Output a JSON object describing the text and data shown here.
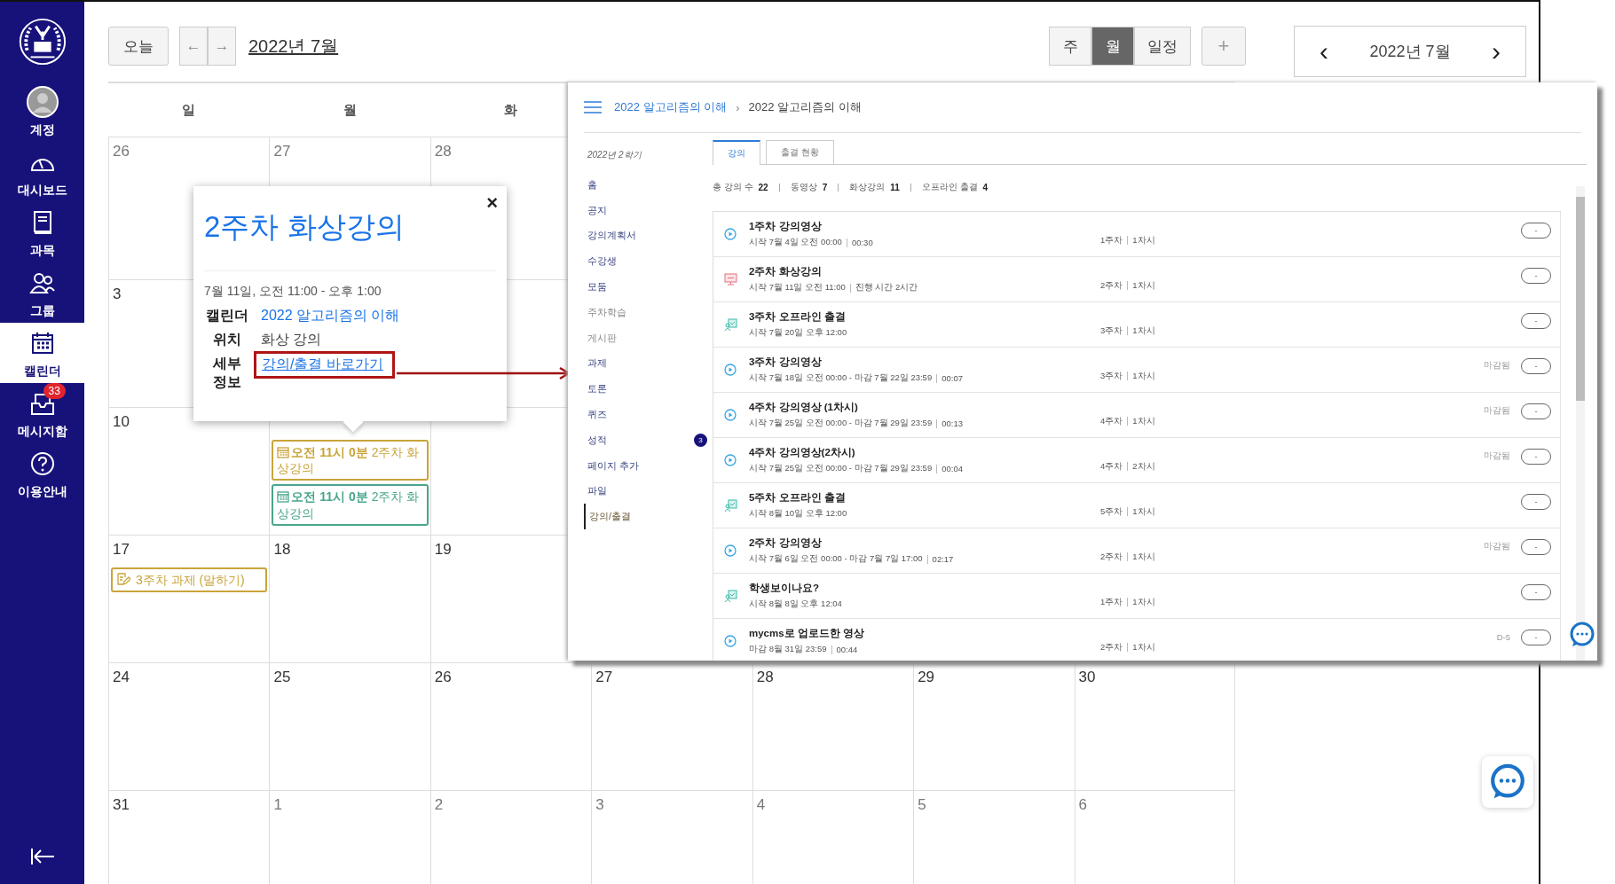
{
  "sidebar": {
    "items": [
      {
        "kind": "account",
        "label": "계정",
        "selected": false
      },
      {
        "kind": "dashboard",
        "label": "대시보드",
        "selected": false
      },
      {
        "kind": "courses",
        "label": "과목",
        "selected": false
      },
      {
        "kind": "groups",
        "label": "그룹",
        "selected": false
      },
      {
        "kind": "calendar",
        "label": "캘린더",
        "selected": true
      },
      {
        "kind": "inbox",
        "label": "메시지함",
        "selected": false,
        "badge": "33"
      },
      {
        "kind": "help",
        "label": "이용안내",
        "selected": false
      }
    ]
  },
  "toolbar": {
    "today": "오늘",
    "prev": "←",
    "next": "→",
    "title": "2022년 7월",
    "views": [
      {
        "label": "주",
        "selected": false
      },
      {
        "label": "월",
        "selected": true
      },
      {
        "label": "일정",
        "selected": false
      }
    ],
    "add": "+"
  },
  "mini_calendar": {
    "prev": "‹",
    "title": "2022년 7월",
    "next": "›"
  },
  "calendar": {
    "weekdays": [
      "일",
      "월",
      "화"
    ],
    "weeks": [
      [
        {
          "day": "26",
          "outside": true
        },
        {
          "day": "27",
          "outside": true
        },
        {
          "day": "28",
          "outside": true
        }
      ],
      [
        {
          "day": "3",
          "outside": false
        }
      ],
      [
        {
          "day": "10",
          "outside": false
        },
        {
          "events": [
            {
              "kind": "event",
              "time": "오전 11시 0분",
              "title": "2주차 화상강의",
              "color": "#c9a43a"
            },
            {
              "kind": "event",
              "time": "오전 11시 0분",
              "title": "2주차 화상강의",
              "color": "#4aa58c"
            }
          ]
        }
      ],
      [
        {
          "day": "17",
          "outside": false,
          "events": [
            {
              "kind": "assignment",
              "title": "3주차 과제 (말하기)",
              "color": "#c9a43a"
            }
          ]
        },
        {
          "day": "18",
          "outside": false
        },
        {
          "day": "19",
          "outside": false
        }
      ],
      [
        {
          "day": "24",
          "outside": false
        },
        {
          "day": "25",
          "outside": false
        },
        {
          "day": "26",
          "outside": false
        },
        {
          "day": "27",
          "outside": false
        },
        {
          "day": "28",
          "outside": false
        },
        {
          "day": "29",
          "outside": false
        },
        {
          "day": "30",
          "outside": false
        }
      ],
      [
        {
          "day": "31",
          "outside": false
        },
        {
          "day": "1",
          "outside": true
        },
        {
          "day": "2",
          "outside": true
        },
        {
          "day": "3",
          "outside": true
        },
        {
          "day": "4",
          "outside": true
        },
        {
          "day": "5",
          "outside": true
        },
        {
          "day": "6",
          "outside": true
        }
      ]
    ]
  },
  "popover": {
    "close": "×",
    "title": "2주차 화상강의",
    "when": "7월 11일, 오전 11:00 - 오후 1:00",
    "rows": [
      {
        "kind": "link",
        "label": "캘린더",
        "value": "2022 알고리즘의 이해"
      },
      {
        "kind": "text",
        "label": "위치",
        "value": "화상 강의"
      },
      {
        "kind": "highlight",
        "label": "세부 정보",
        "value": "강의/출결 바로가기"
      }
    ]
  },
  "course_page": {
    "breadcrumb": [
      "2022 알고리즘의 이해",
      "›",
      "2022 알고리즘의 이해"
    ],
    "term": "2022년 2학기",
    "nav": [
      {
        "label": "홈",
        "selected": false,
        "disabled": false
      },
      {
        "label": "공지",
        "selected": false,
        "disabled": false
      },
      {
        "label": "강의계획서",
        "selected": false,
        "disabled": false
      },
      {
        "label": "수강생",
        "selected": false,
        "disabled": false
      },
      {
        "label": "모둠",
        "selected": false,
        "disabled": false
      },
      {
        "label": "주차학습",
        "selected": false,
        "disabled": true
      },
      {
        "label": "게시판",
        "selected": false,
        "disabled": true
      },
      {
        "label": "과제",
        "selected": false,
        "disabled": false
      },
      {
        "label": "토론",
        "selected": false,
        "disabled": false
      },
      {
        "label": "퀴즈",
        "selected": false,
        "disabled": false
      },
      {
        "label": "성적",
        "selected": false,
        "disabled": false,
        "badge": "3"
      },
      {
        "label": "페이지 추가",
        "selected": false,
        "disabled": false
      },
      {
        "label": "파일",
        "selected": false,
        "disabled": false
      },
      {
        "label": "강의/출결",
        "selected": true,
        "disabled": false
      }
    ],
    "tabs": [
      {
        "label": "강의",
        "selected": true
      },
      {
        "label": "출결 현황",
        "selected": false
      }
    ],
    "stats": [
      {
        "label": "총 강의 수",
        "value": "22"
      },
      {
        "label": "동영상",
        "value": "7"
      },
      {
        "label": "화상강의",
        "value": "11"
      },
      {
        "label": "오프라인 출결",
        "value": "4"
      }
    ],
    "lectures": [
      {
        "kind": "video",
        "title": "1주차 강의영상",
        "meta": [
          "시작  7월 4일 오전 00:00",
          "00:30"
        ],
        "week": "1주차",
        "period": "1차시",
        "action": "-"
      },
      {
        "kind": "live",
        "title": "2주차 화상강의",
        "meta": [
          "시작  7월 11일 오전 11:00",
          "진행 시간 2시간"
        ],
        "week": "2주차",
        "period": "1차시",
        "action": "-"
      },
      {
        "kind": "offline",
        "title": "3주차 오프라인 출결",
        "meta": [
          "시작  7월 20일 오후 12:00"
        ],
        "week": "3주차",
        "period": "1차시",
        "action": "-"
      },
      {
        "kind": "video",
        "title": "3주차 강의영상",
        "meta": [
          "시작  7월 18일 오전 00:00  -  마감  7월 22일 23:59",
          "00:07"
        ],
        "week": "3주차",
        "period": "1차시",
        "status": "마감됨",
        "action": "-"
      },
      {
        "kind": "video",
        "title": "4주차 강의영상 (1차시)",
        "meta": [
          "시작  7월 25일 오전 00:00  -  마감  7월 29일 23:59",
          "00:13"
        ],
        "week": "4주차",
        "period": "1차시",
        "status": "마감됨",
        "action": "-"
      },
      {
        "kind": "video",
        "title": "4주차 강의영상(2차시)",
        "meta": [
          "시작  7월 25일 오전 00:00  -  마감  7월 29일 23:59",
          "00:04"
        ],
        "week": "4주차",
        "period": "2차시",
        "status": "마감됨",
        "action": "-"
      },
      {
        "kind": "offline",
        "title": "5주차 오프라인 출결",
        "meta": [
          "시작  8월 10일 오후 12:00"
        ],
        "week": "5주차",
        "period": "1차시",
        "action": "-"
      },
      {
        "kind": "video",
        "title": "2주차 강의영상",
        "meta": [
          "시작  7월 6일 오전 00:00  -  마감  7월 7일 17:00",
          "02:17"
        ],
        "week": "2주차",
        "period": "1차시",
        "status": "마감됨",
        "action": "-"
      },
      {
        "kind": "offline",
        "title": "학생보이나요?",
        "meta": [
          "시작  8월 8일 오후 12:04"
        ],
        "week": "1주차",
        "period": "1차시",
        "action": "-"
      },
      {
        "kind": "video",
        "title": "mycms로 업로드한 영상",
        "meta": [
          "마감  8월 31일 23:59",
          "00:44"
        ],
        "week": "2주차",
        "period": "1차시",
        "status": "D-5",
        "action": "-"
      }
    ]
  }
}
